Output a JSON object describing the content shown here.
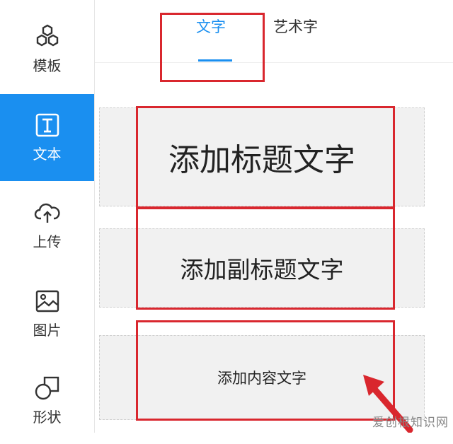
{
  "sidebar": {
    "items": [
      {
        "label": "模板",
        "icon": "template-icon"
      },
      {
        "label": "文本",
        "icon": "text-icon",
        "active": true
      },
      {
        "label": "上传",
        "icon": "upload-icon"
      },
      {
        "label": "图片",
        "icon": "image-icon"
      },
      {
        "label": "形状",
        "icon": "shape-icon"
      }
    ]
  },
  "tabs": [
    {
      "label": "文字",
      "active": true
    },
    {
      "label": "艺术字"
    }
  ],
  "cards": {
    "title": "添加标题文字",
    "subtitle": "添加副标题文字",
    "body": "添加内容文字"
  },
  "watermark": "爱创根知识网",
  "colors": {
    "accent": "#1a8ff0",
    "annotation": "#d9272e"
  }
}
